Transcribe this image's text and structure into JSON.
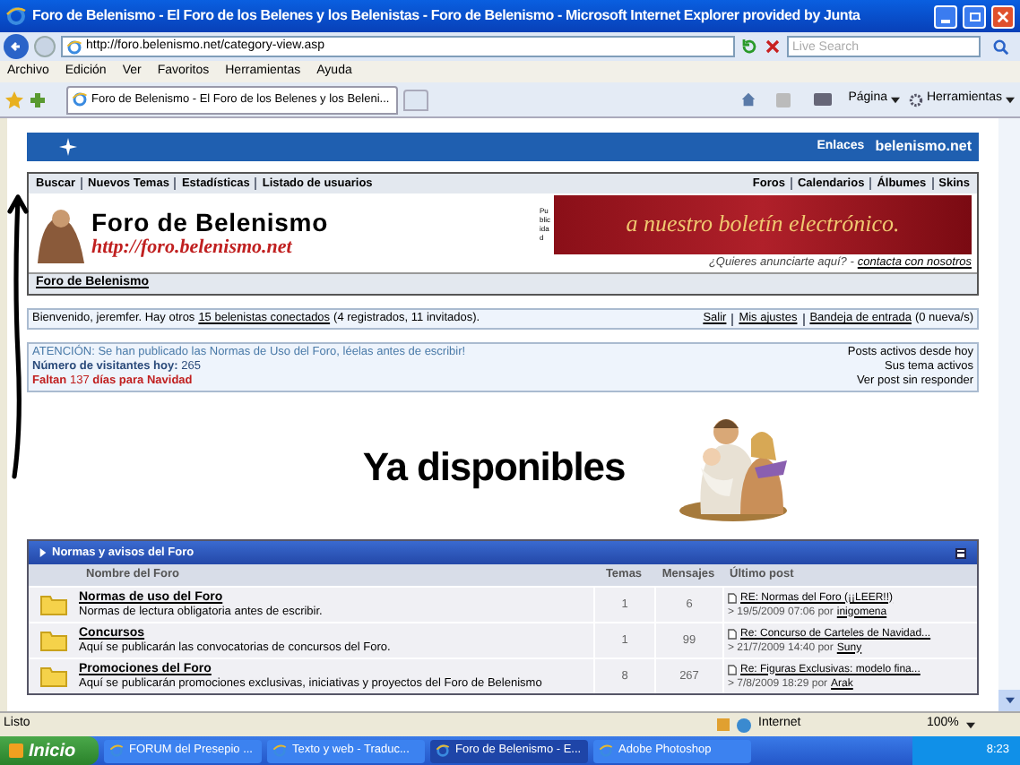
{
  "window": {
    "title": "Foro de Belenismo - El Foro de los Belenes y los Belenistas - Foro de Belenismo - Microsoft Internet Explorer provided by Junta"
  },
  "address": {
    "url": "http://foro.belenismo.net/category-view.asp"
  },
  "search": {
    "placeholder": "Live Search"
  },
  "menu": [
    "Archivo",
    "Edición",
    "Ver",
    "Favoritos",
    "Herramientas",
    "Ayuda"
  ],
  "tab": {
    "title": "Foro de Belenismo - El Foro de los Belenes y los Beleni..."
  },
  "toolbar": [
    "Página",
    "Herramientas"
  ],
  "banner": {
    "links_label": "Enlaces",
    "site": "belenismo.net"
  },
  "nav_left": [
    "Buscar",
    "Nuevos Temas",
    "Estadísticas",
    "Listado de usuarios"
  ],
  "nav_right": [
    "Foros",
    "Calendarios",
    "Álbumes",
    "Skins"
  ],
  "logo": {
    "title": "Foro de Belenismo",
    "url": "http://foro.belenismo.net"
  },
  "ad": {
    "side_label": "Publicidad",
    "text": "a nuestro boletín electrónico.",
    "prompt": "¿Quieres anunciarte aquí? -",
    "link": "contacta con nosotros"
  },
  "breadcrumb": "Foro de Belenismo",
  "welcome": {
    "before": "Bienvenido, jeremfer. Hay otros",
    "link": "15 belenistas conectados",
    "after": "(4 registrados, 11 invitados).",
    "links": [
      "Salir",
      "Mis ajustes",
      "Bandeja de entrada"
    ],
    "inbox_count": "(0 nueva/s)"
  },
  "notice": {
    "lines": [
      "ATENCIÓN: Se han publicado las Normas de Uso del Foro, léelas antes de escribir!",
      "**Número de visitantes hoy:** 265",
      "**Faltan** 137 **días para Navidad**"
    ],
    "links": [
      "Posts activos desde hoy",
      "Sus tema activos",
      "Ver post sin responder"
    ]
  },
  "promo": {
    "headline": "Ya disponibles",
    "kind": "picture"
  },
  "forum_table": {
    "title": "Normas y avisos del Foro",
    "expanded": true,
    "columns": [
      "Nombre del Foro",
      "Temas",
      "Mensajes",
      "Último post"
    ],
    "rows": [
      {
        "name": "Normas de uso del Foro",
        "description": "Normas de lectura obligatoria antes de escribir.",
        "topics": "1",
        "posts": "6",
        "last_title": "RE: Normas del Foro (¡¡LEER!!)",
        "last_date": "> 19/5/2009 07:06 por",
        "last_user": "inigomena"
      },
      {
        "name": "Concursos",
        "description": "Aquí se publicarán las convocatorias de concursos del Foro.",
        "topics": "1",
        "posts": "99",
        "last_title": "Re: Concurso de Carteles de Navidad...",
        "last_date": "> 21/7/2009 14:40 por",
        "last_user": "Suny"
      },
      {
        "name": "Promociones del Foro",
        "description": "Aquí se publicarán promociones exclusivas, iniciativas y proyectos del Foro de Belenismo",
        "topics": "8",
        "posts": "267",
        "last_title": "Re: Figuras Exclusivas: modelo fina...",
        "last_date": "> 7/8/2009 18:29 por",
        "last_user": "Arak"
      }
    ]
  },
  "status_bar": {
    "text": "Listo",
    "zone": "Internet",
    "zoom": "100%"
  },
  "taskbar": {
    "start": "Inicio",
    "items": [
      {
        "label": "FORUM del Presepio ...",
        "selected": false
      },
      {
        "label": "Texto y web - Traduc...",
        "selected": false
      },
      {
        "label": "Foro de Belenismo - E...",
        "selected": true
      },
      {
        "label": "Adobe Photoshop",
        "selected": false
      }
    ],
    "clock": "8:23"
  }
}
